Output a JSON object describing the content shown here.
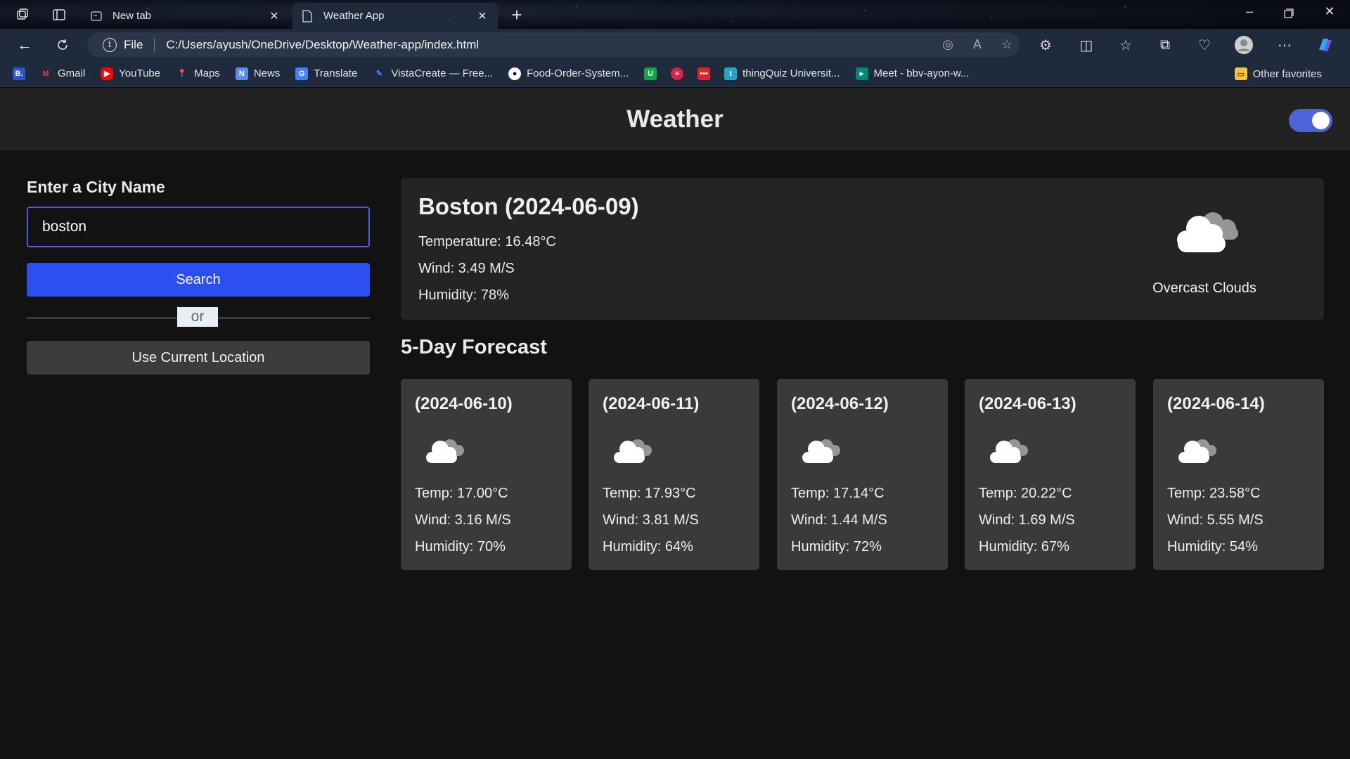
{
  "browser": {
    "tabs": [
      {
        "title": "New tab",
        "active": false
      },
      {
        "title": "Weather App",
        "active": true
      }
    ],
    "address": {
      "scheme_label": "File",
      "url": "C:/Users/ayush/OneDrive/Desktop/Weather-app/index.html"
    },
    "bookmarks": [
      {
        "label": "Gmail",
        "icon": "gmail-icon",
        "color": "#ea4335"
      },
      {
        "label": "YouTube",
        "icon": "youtube-icon",
        "color": "#ff0000"
      },
      {
        "label": "Maps",
        "icon": "maps-icon",
        "color": "#34a853"
      },
      {
        "label": "News",
        "icon": "news-icon",
        "color": "#5b8def"
      },
      {
        "label": "Translate",
        "icon": "translate-icon",
        "color": "#4285f4"
      },
      {
        "label": "VistaCreate — Free...",
        "icon": "vistacreate-icon",
        "color": "#3b82f6"
      },
      {
        "label": "Food-Order-System...",
        "icon": "github-icon",
        "color": "#ffffff"
      },
      {
        "label": "thingQuiz Universit...",
        "icon": "thingquiz-icon",
        "color": "#22a6c7"
      },
      {
        "label": "Meet - bbv-ayon-w...",
        "icon": "meet-icon",
        "color": "#00897b"
      }
    ],
    "other_favorites": "Other favorites"
  },
  "app": {
    "title": "Weather",
    "theme_toggle_on": true,
    "accent_color": "#2c4ff0",
    "search": {
      "label": "Enter a City Name",
      "value": "boston",
      "button_label": "Search",
      "separator": "or",
      "location_button_label": "Use Current Location"
    },
    "current": {
      "heading": "Boston (2024-06-09)",
      "temperature": "Temperature: 16.48°C",
      "wind": "Wind: 3.49 M/S",
      "humidity": "Humidity: 78%",
      "icon": "overcast-cloud-icon",
      "description": "Overcast Clouds"
    },
    "forecast_title": "5-Day Forecast",
    "forecast": [
      {
        "date": "(2024-06-10)",
        "temp": "Temp: 17.00°C",
        "wind": "Wind: 3.16 M/S",
        "humidity": "Humidity: 70%",
        "icon": "cloud-icon"
      },
      {
        "date": "(2024-06-11)",
        "temp": "Temp: 17.93°C",
        "wind": "Wind: 3.81 M/S",
        "humidity": "Humidity: 64%",
        "icon": "cloud-icon"
      },
      {
        "date": "(2024-06-12)",
        "temp": "Temp: 17.14°C",
        "wind": "Wind: 1.44 M/S",
        "humidity": "Humidity: 72%",
        "icon": "cloud-icon"
      },
      {
        "date": "(2024-06-13)",
        "temp": "Temp: 20.22°C",
        "wind": "Wind: 1.69 M/S",
        "humidity": "Humidity: 67%",
        "icon": "cloud-icon"
      },
      {
        "date": "(2024-06-14)",
        "temp": "Temp: 23.58°C",
        "wind": "Wind: 5.55 M/S",
        "humidity": "Humidity: 54%",
        "icon": "cloud-icon"
      }
    ]
  }
}
